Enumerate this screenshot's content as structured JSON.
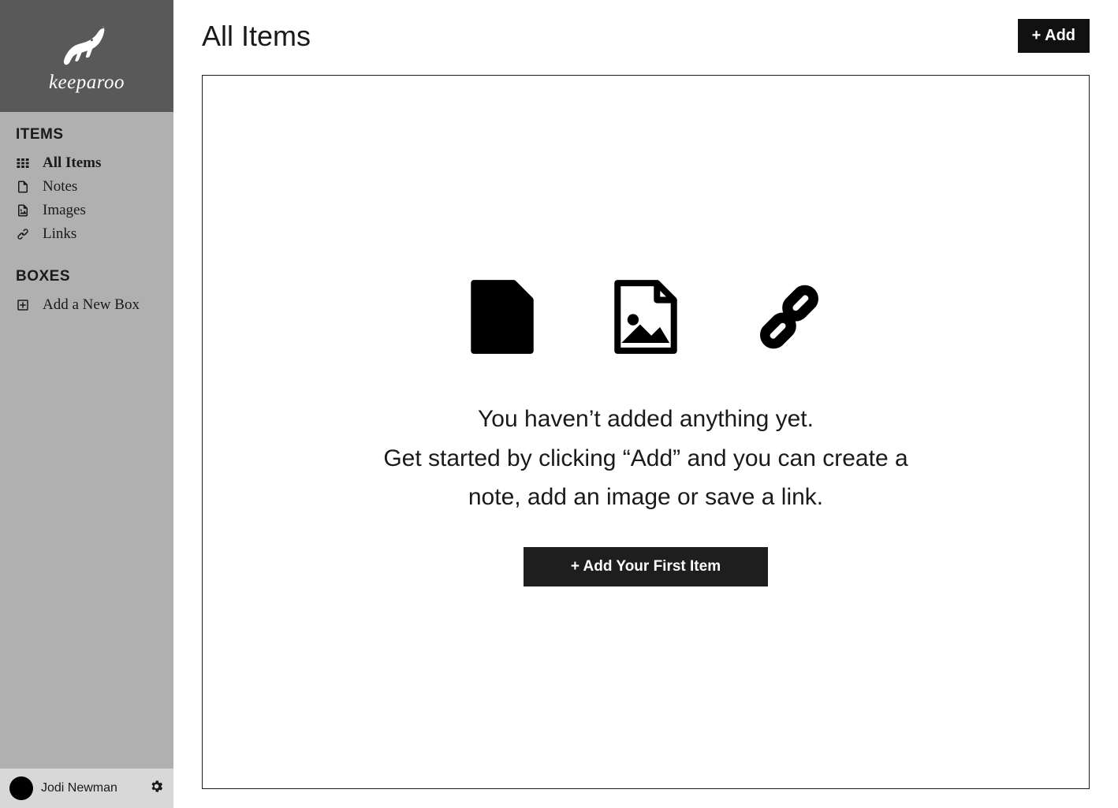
{
  "brand": {
    "name": "keeparoo"
  },
  "sidebar": {
    "items_header": "ITEMS",
    "boxes_header": "BOXES",
    "items": [
      {
        "label": "All Items"
      },
      {
        "label": "Notes"
      },
      {
        "label": "Images"
      },
      {
        "label": "Links"
      }
    ],
    "boxes": [
      {
        "label": "Add a New Box"
      }
    ]
  },
  "user": {
    "name": "Jodi Newman"
  },
  "header": {
    "title": "All Items",
    "add_label": "+ Add"
  },
  "empty": {
    "line1": "You haven’t added anything yet.",
    "line2": "Get started by clicking “Add” and you can create a note, add an image or save a link.",
    "cta_label": "+ Add Your First Item"
  }
}
